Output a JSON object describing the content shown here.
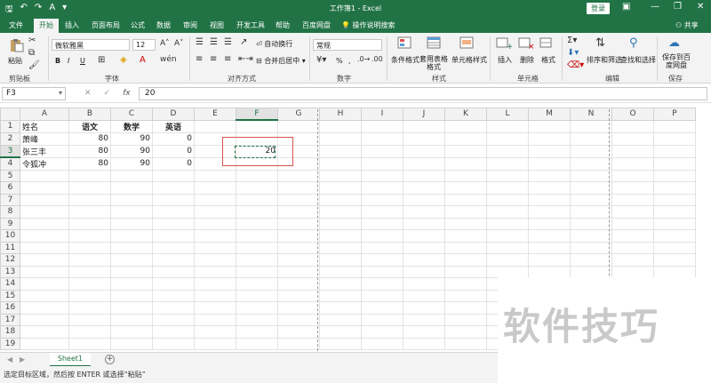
{
  "window": {
    "title": "工作簿1 - Excel",
    "login_label": "登录",
    "share_label": "共享",
    "accent_color": "#217346"
  },
  "tabs": [
    "文件",
    "开始",
    "插入",
    "页面布局",
    "公式",
    "数据",
    "审阅",
    "视图",
    "开发工具",
    "帮助",
    "百度网盘"
  ],
  "tell_me": "操作说明搜索",
  "ribbon": {
    "clipboard": {
      "paste": "粘贴",
      "label": "剪贴板"
    },
    "font": {
      "name": "微软雅黑",
      "size": "12",
      "label": "字体",
      "bold": "B",
      "italic": "I",
      "underline": "U"
    },
    "alignment": {
      "wrap": "自动换行",
      "merge": "合并后居中",
      "label": "对齐方式"
    },
    "number": {
      "format": "常规",
      "label": "数字",
      "percent": "%",
      "comma": ","
    },
    "styles": {
      "conditional": "条件格式",
      "table": "套用表格格式",
      "cell_styles": "单元格样式",
      "label": "样式"
    },
    "cells": {
      "insert": "插入",
      "delete": "删除",
      "format": "格式",
      "label": "单元格"
    },
    "editing": {
      "sort": "排序和筛选",
      "find": "查找和选择",
      "label": "编辑"
    },
    "save": {
      "save_to": "保存到百度网盘",
      "label": "保存"
    }
  },
  "formula_bar": {
    "name_box": "F3",
    "formula": "20",
    "fx": "fx"
  },
  "grid": {
    "columns": [
      "A",
      "B",
      "C",
      "D",
      "E",
      "F",
      "G",
      "H",
      "I",
      "J",
      "K",
      "L",
      "M",
      "N",
      "O",
      "P"
    ],
    "rows": [
      [
        "姓名",
        "语文",
        "数学",
        "英语",
        "",
        "",
        ""
      ],
      [
        "萧峰",
        "80",
        "90",
        "0",
        "",
        "",
        ""
      ],
      [
        "张三丰",
        "80",
        "90",
        "0",
        "",
        "20",
        ""
      ],
      [
        "令狐冲",
        "80",
        "90",
        "0",
        "",
        "",
        ""
      ]
    ],
    "row_count": 20,
    "selected_cell": "F3"
  },
  "sheets": [
    "Sheet1"
  ],
  "status": "选定目标区域，然后按 ENTER 或选择“粘贴”",
  "watermark": "软件技巧"
}
